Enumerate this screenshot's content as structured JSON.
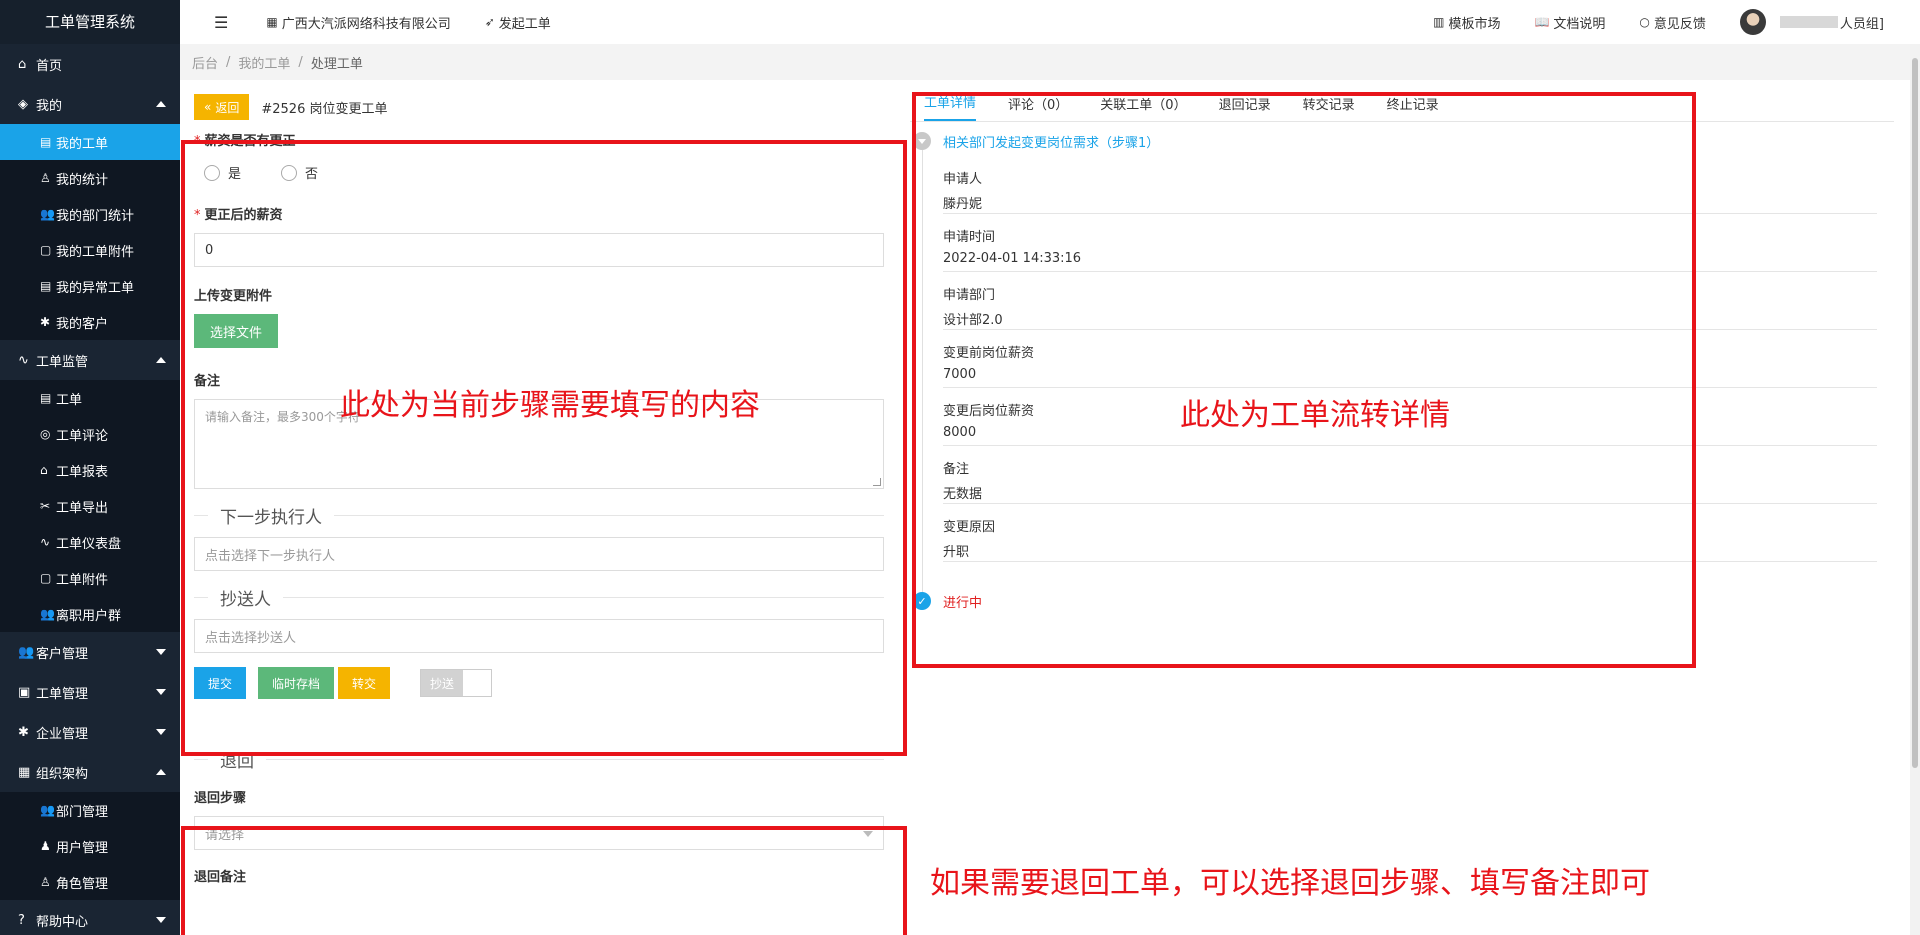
{
  "app": {
    "title": "工单管理系统"
  },
  "sidebar": {
    "groups": [
      {
        "label": "首页",
        "icon": "home-icon",
        "items": []
      },
      {
        "label": "我的",
        "icon": "layers-icon",
        "expanded": true,
        "items": [
          {
            "label": "我的工单",
            "icon": "file-icon",
            "active": true
          },
          {
            "label": "我的统计",
            "icon": "user-icon"
          },
          {
            "label": "我的部门统计",
            "icon": "users-icon"
          },
          {
            "label": "我的工单附件",
            "icon": "file-icon"
          },
          {
            "label": "我的异常工单",
            "icon": "file-icon"
          },
          {
            "label": "我的客户",
            "icon": "gear-icon"
          }
        ]
      },
      {
        "label": "工单监管",
        "icon": "pulse-icon",
        "expanded": true,
        "items": [
          {
            "label": "工单",
            "icon": "file-icon"
          },
          {
            "label": "工单评论",
            "icon": "comment-icon"
          },
          {
            "label": "工单报表",
            "icon": "home-icon"
          },
          {
            "label": "工单导出",
            "icon": "export-icon"
          },
          {
            "label": "工单仪表盘",
            "icon": "pulse-icon"
          },
          {
            "label": "工单附件",
            "icon": "file-icon"
          },
          {
            "label": "离职用户群",
            "icon": "users-icon"
          }
        ]
      },
      {
        "label": "客户管理",
        "icon": "users-icon",
        "expanded": false,
        "items": []
      },
      {
        "label": "工单管理",
        "icon": "clipboard-icon",
        "expanded": false,
        "items": []
      },
      {
        "label": "企业管理",
        "icon": "gear-icon",
        "expanded": false,
        "items": []
      },
      {
        "label": "组织架构",
        "icon": "calendar-icon",
        "expanded": true,
        "items": [
          {
            "label": "部门管理",
            "icon": "users-icon"
          },
          {
            "label": "用户管理",
            "icon": "user-icon"
          },
          {
            "label": "角色管理",
            "icon": "user-icon"
          }
        ]
      },
      {
        "label": "帮助中心",
        "icon": "question-icon",
        "expanded": false,
        "items": []
      }
    ]
  },
  "header": {
    "company": "广西大汽派网络科技有限公司",
    "create_ticket": "发起工单",
    "template_market": "模板市场",
    "docs": "文档说明",
    "feedback": "意见反馈",
    "user_suffix": "人员组]"
  },
  "breadcrumb": [
    "后台",
    "我的工单",
    "处理工单"
  ],
  "form": {
    "back_label": "返回",
    "ticket_title": "#2526 岗位变更工单",
    "salary_change_label": "薪资是否有更正",
    "radio_yes": "是",
    "radio_no": "否",
    "new_salary_label": "更正后的薪资",
    "new_salary_value": "0",
    "upload_label": "上传变更附件",
    "choose_file": "选择文件",
    "remark_label": "备注",
    "remark_placeholder": "请输入备注，最多300个字符",
    "next_executor_title": "下一步执行人",
    "next_executor_placeholder": "点击选择下一步执行人",
    "cc_title": "抄送人",
    "cc_placeholder": "点击选择抄送人",
    "submit": "提交",
    "save_draft": "临时存档",
    "transfer": "转交",
    "cc_toggle": "抄送",
    "return_title": "退回",
    "return_step_label": "退回步骤",
    "return_step_placeholder": "请选择",
    "return_remark_label": "退回备注"
  },
  "detail": {
    "tabs": [
      "工单详情",
      "评论（0）",
      "关联工单（0）",
      "退回记录",
      "转交记录",
      "终止记录"
    ],
    "step_title": "相关部门发起变更岗位需求（步骤1）",
    "fields": [
      {
        "k": "申请人",
        "v": "滕丹妮"
      },
      {
        "k": "申请时间",
        "v": "2022-04-01 14:33:16"
      },
      {
        "k": "申请部门",
        "v": "设计部2.0"
      },
      {
        "k": "变更前岗位薪资",
        "v": "7000"
      },
      {
        "k": "变更后岗位薪资",
        "v": "8000"
      },
      {
        "k": "备注",
        "v": "无数据"
      },
      {
        "k": "变更原因",
        "v": "升职"
      }
    ],
    "status": "进行中"
  },
  "annotations": {
    "left": "此处为当前步骤需要填写的内容",
    "right": "此处为工单流转详情",
    "bottom": "如果需要退回工单，可以选择退回步骤、填写备注即可"
  },
  "colors": {
    "accent": "#1aa3e8",
    "sidebar": "#1a2533",
    "warning": "#f5b400",
    "success": "#5cb87a",
    "annotation": "#e8141a"
  }
}
